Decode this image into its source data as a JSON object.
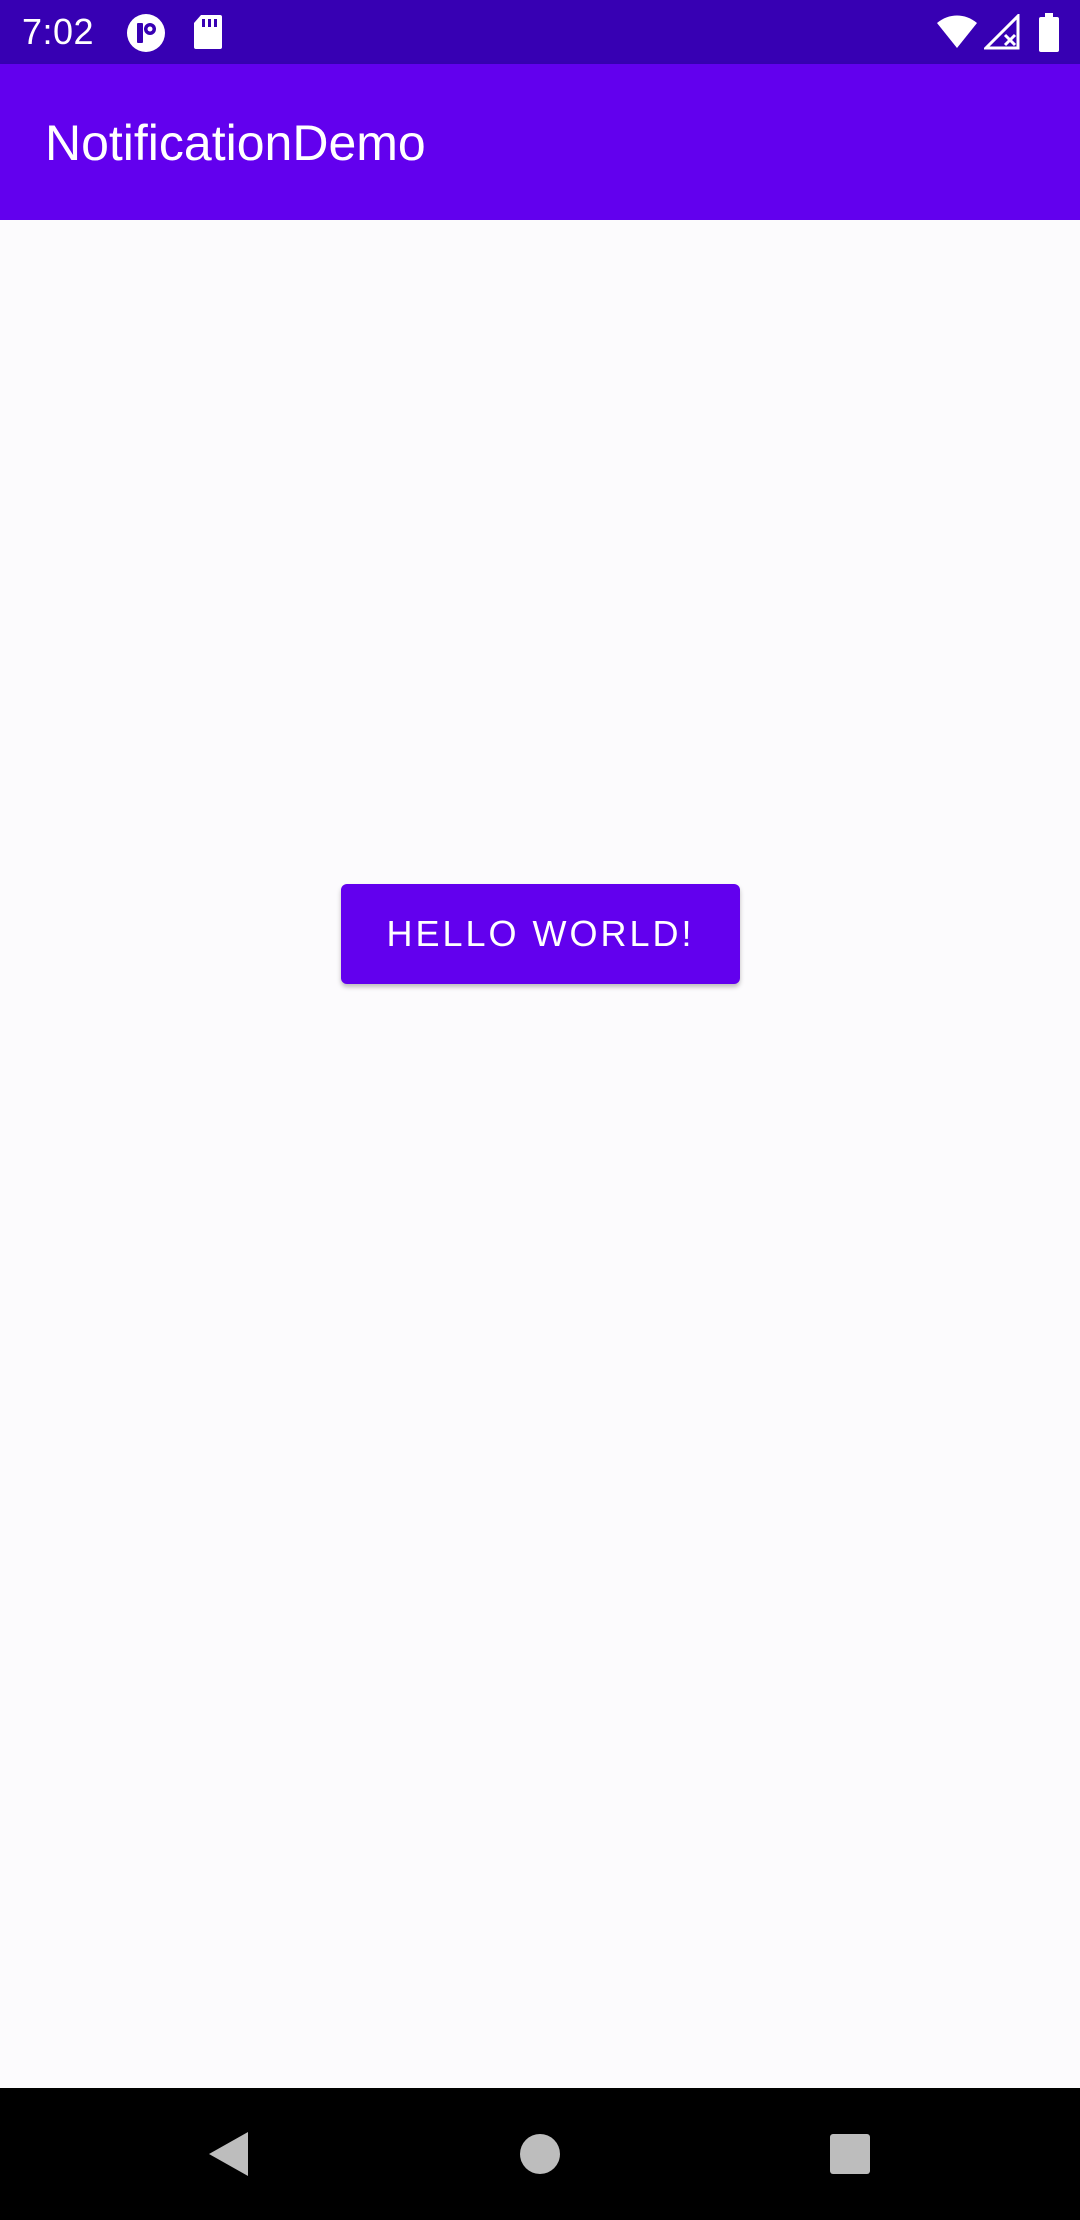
{
  "status_bar": {
    "time": "7:02",
    "icons": [
      "app-notification-icon",
      "sd-card-icon",
      "wifi-icon",
      "cellular-no-signal-icon",
      "battery-icon"
    ]
  },
  "app_bar": {
    "title": "NotificationDemo"
  },
  "main": {
    "button_label": "HELLO WORLD!"
  },
  "nav_bar": {
    "buttons": [
      "back-icon",
      "home-icon",
      "recents-icon"
    ]
  },
  "colors": {
    "status_bar": "#3700b3",
    "app_bar": "#6200ee",
    "button": "#6200ee",
    "background": "#fcfbfd"
  }
}
